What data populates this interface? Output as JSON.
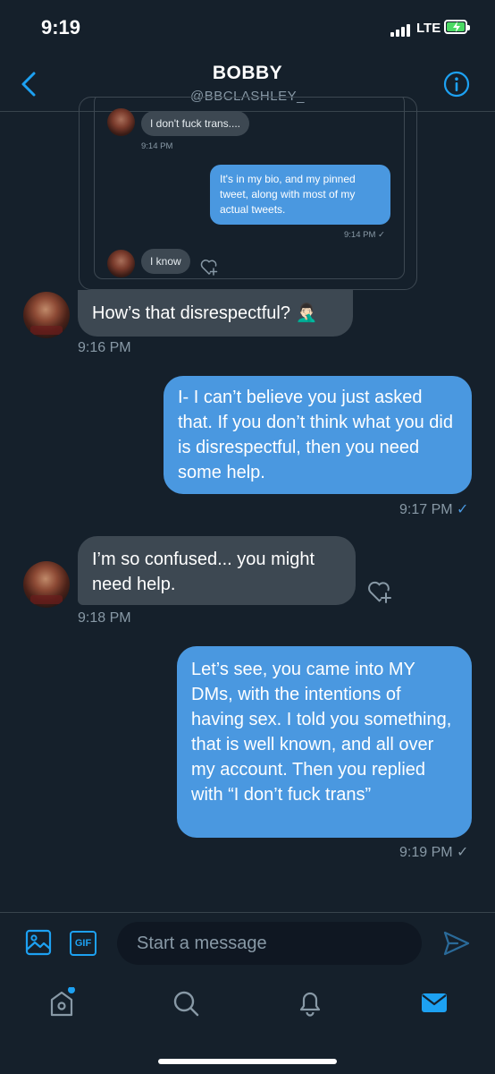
{
  "status_bar": {
    "time": "9:19",
    "network": "LTE"
  },
  "header": {
    "name": "BOBBY",
    "handle": "@BBCLASHLEY_"
  },
  "quoted_conversation": {
    "messages": [
      {
        "direction": "incoming",
        "text": "I don't fuck trans....",
        "time": "9:14 PM"
      },
      {
        "direction": "outgoing",
        "text": "It's in my bio, and my pinned tweet, along with most of my actual tweets.",
        "time": "9:14 PM ✓"
      },
      {
        "direction": "incoming",
        "text": "I know"
      }
    ]
  },
  "messages": [
    {
      "direction": "incoming",
      "text": "How’s that disrespectful? 🤦🏻‍♂️",
      "time": "9:16 PM"
    },
    {
      "direction": "outgoing",
      "text": "I- I can’t believe you just asked that. If you don’t think what you did is disrespectful, then you need some help.",
      "time": "9:17 PM",
      "check": "✓"
    },
    {
      "direction": "incoming",
      "text": "I’m so confused... you might need help.",
      "time": "9:18 PM"
    },
    {
      "direction": "outgoing",
      "text": "Let’s see, you came into MY DMs, with the intentions of having sex. I told you something, that is well known, and all over my account. Then you replied with “I don’t fuck trans”",
      "time": "9:19 PM",
      "check": "✓"
    }
  ],
  "composer": {
    "placeholder": "Start a message",
    "gif_label": "GIF"
  },
  "tabs": [
    "home",
    "search",
    "notifications",
    "messages"
  ],
  "colors": {
    "background": "#15202b",
    "accent": "#1da1f2",
    "outgoing_bubble": "#4a98e0",
    "incoming_bubble": "#3d4852",
    "muted_text": "#8899a6"
  }
}
